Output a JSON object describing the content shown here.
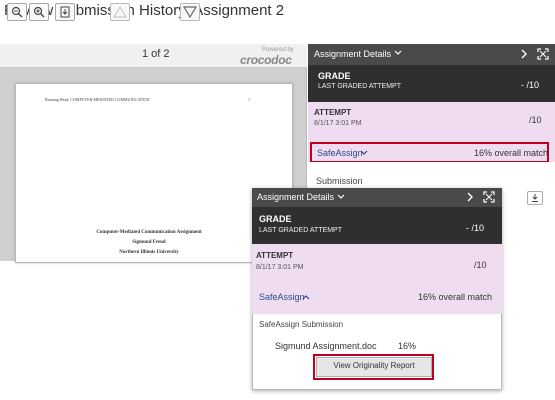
{
  "page": {
    "title": "Review Submission History: Assignment 2"
  },
  "viewer": {
    "page_counter": "1 of 2",
    "brand_powered": "Powered by",
    "brand_name": "crocodoc",
    "doc": {
      "running_head": "Running Head: COMPUTER-MEDIATED COMMUNICATION",
      "page_number": "1",
      "lines": [
        "Computer-Mediated Communication Assignment",
        "Sigmund Freud",
        "Northern Illinois University"
      ]
    }
  },
  "panel": {
    "header": "Assignment Details",
    "grade_label": "GRADE",
    "grade_sub": "LAST GRADED ATTEMPT",
    "grade_value": "- /10",
    "attempt_label": "ATTEMPT",
    "attempt_date": "8/1/17 3:01 PM",
    "attempt_score": "/10",
    "safeassign_label": "SafeAssign",
    "overall_match": "16% overall match",
    "submission_label": "Submission"
  },
  "popup": {
    "header": "Assignment Details",
    "grade_label": "GRADE",
    "grade_sub": "LAST GRADED ATTEMPT",
    "grade_value": "- /10",
    "attempt_label": "ATTEMPT",
    "attempt_date": "8/1/17 3:01 PM",
    "attempt_score": "/10",
    "safeassign_label": "SafeAssign",
    "overall_match": "16% overall match",
    "safeassign_submission": "SafeAssign Submission",
    "file_name": "Sigmund Assignment.doc",
    "file_match": "16%",
    "report_button": "View Originality Report"
  },
  "colors": {
    "highlight_box": "#c00020",
    "dark_header": "#4a4a4a",
    "grade_bg": "#2f2f2f",
    "attempt_bg": "#f0dcf0",
    "link": "#2a4a8a"
  }
}
